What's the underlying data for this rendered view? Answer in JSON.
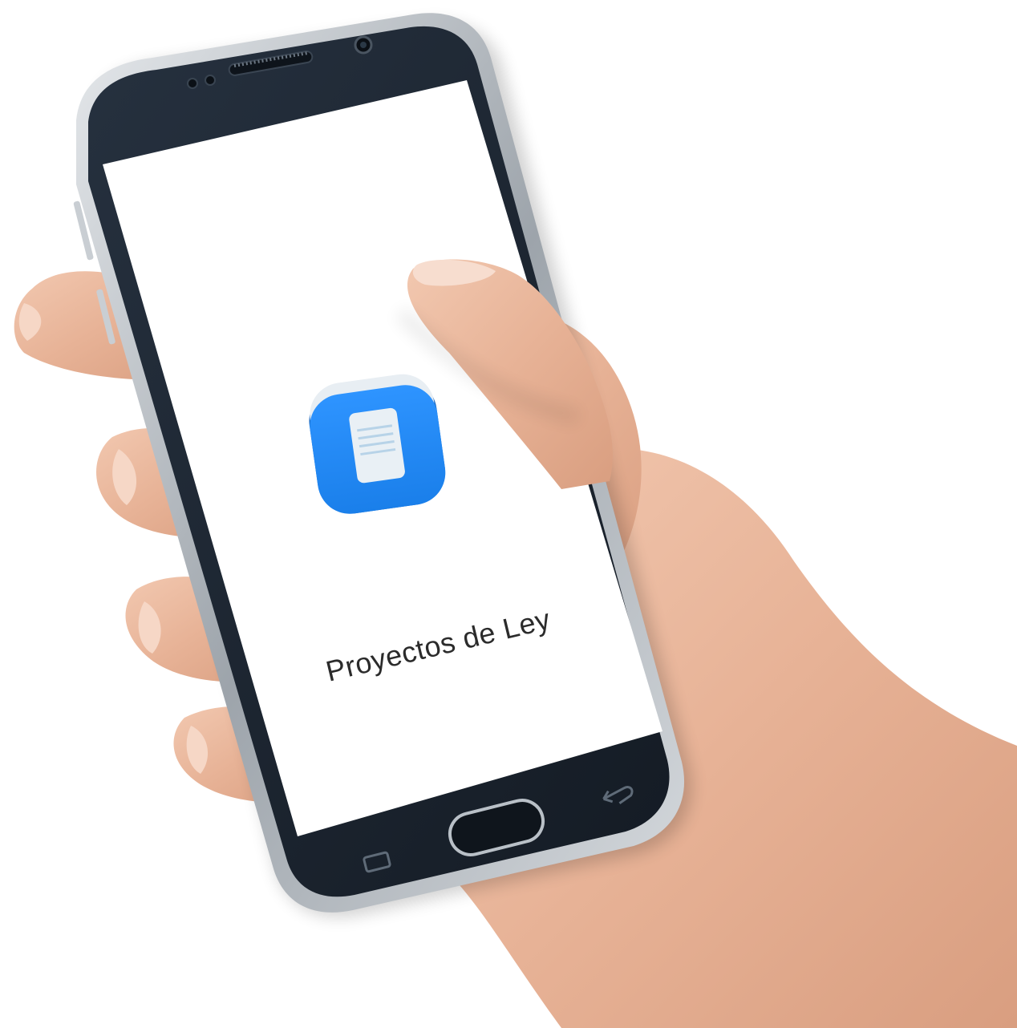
{
  "app": {
    "name": "Proyectos de Ley",
    "icon": "document-icon"
  },
  "colors": {
    "app_icon_blue": "#1E88F5",
    "app_icon_shadow_blue": "#1565C0",
    "document_page": "#E9F0F5",
    "document_lines": "#B7D3E8",
    "screen_background": "#FFFFFF",
    "phone_body": "#1C2633",
    "phone_frame": "#B9BEC3",
    "skin": "#E8B89E"
  },
  "device": {
    "hardware_buttons": [
      "home-button",
      "back-button",
      "recent-apps-button"
    ]
  }
}
